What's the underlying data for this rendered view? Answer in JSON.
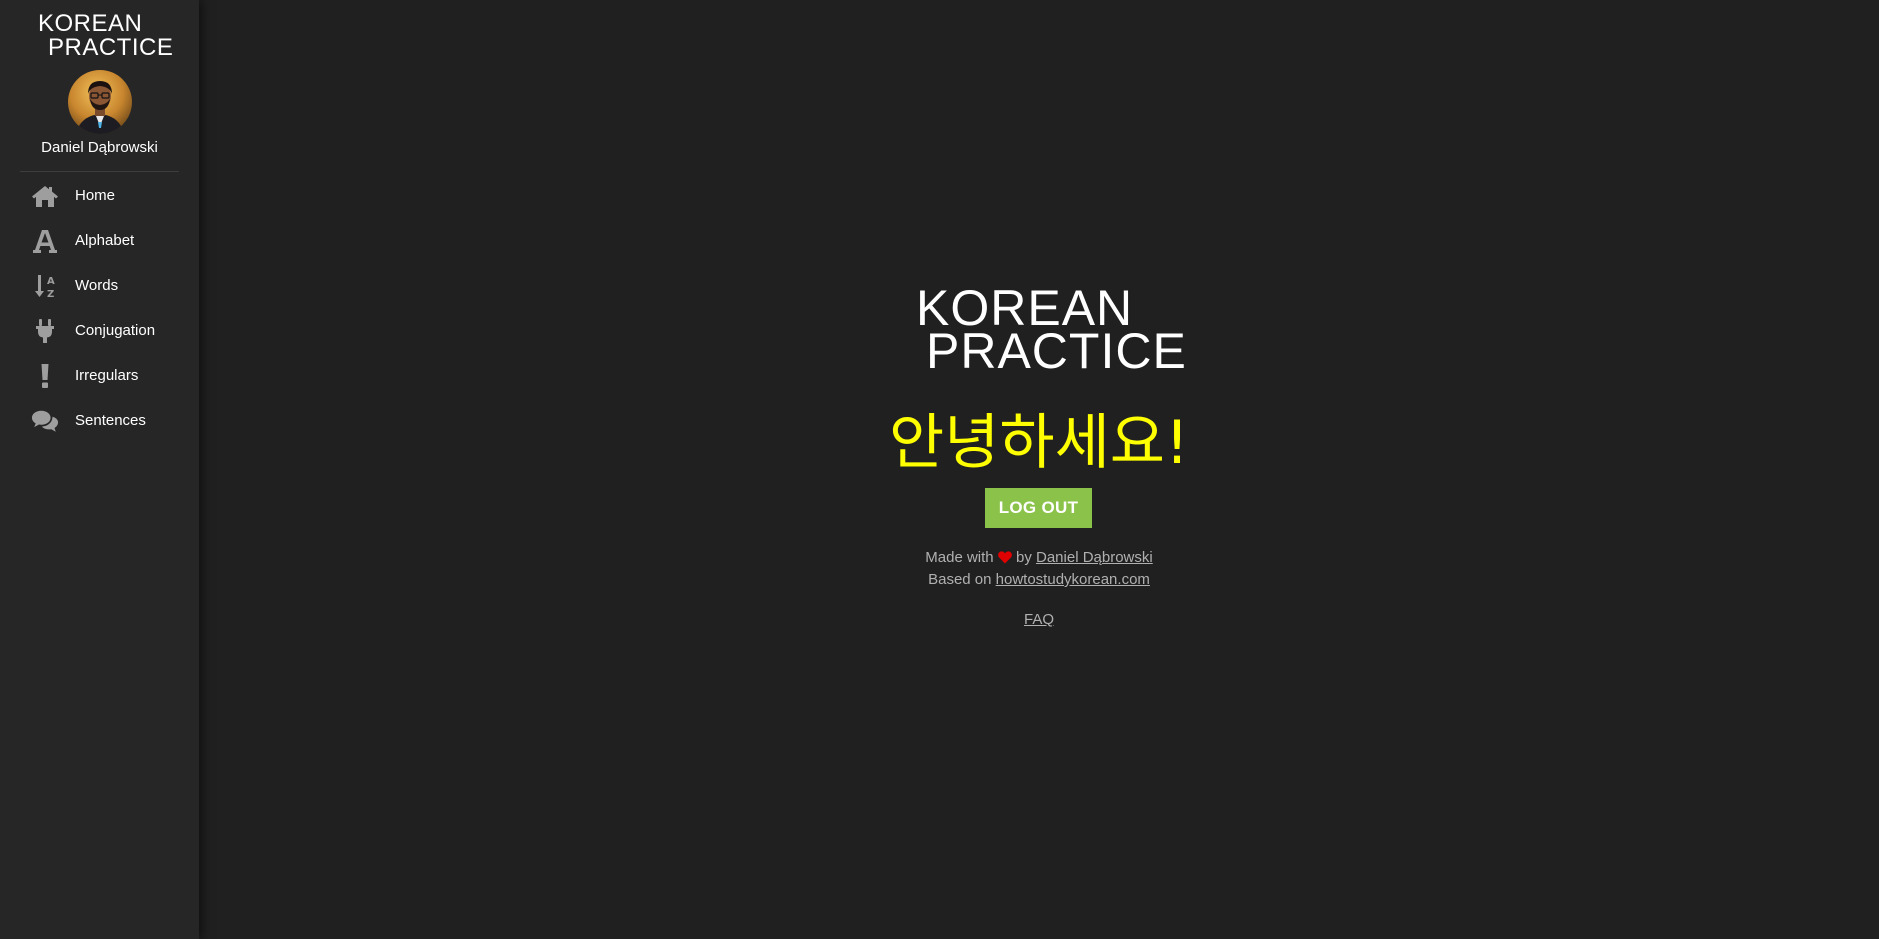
{
  "sidebar": {
    "logo_line1": "KOREAN",
    "logo_line2": "PRACTICE",
    "username": "Daniel Dąbrowski",
    "items": [
      {
        "label": "Home",
        "icon": "home-icon"
      },
      {
        "label": "Alphabet",
        "icon": "font-icon"
      },
      {
        "label": "Words",
        "icon": "sort-alpha-icon"
      },
      {
        "label": "Conjugation",
        "icon": "plug-icon"
      },
      {
        "label": "Irregulars",
        "icon": "exclamation-icon"
      },
      {
        "label": "Sentences",
        "icon": "comments-icon"
      }
    ]
  },
  "main": {
    "logo_line1": "KOREAN",
    "logo_line2": "PRACTICE",
    "greeting": "안녕하세요!",
    "logout_label": "LOG OUT",
    "footer": {
      "made_with": "Made with",
      "by": "by",
      "author_link": "Daniel Dąbrowski",
      "based_on": "Based on",
      "source_link": "howtostudykorean.com",
      "faq_link": "FAQ"
    }
  },
  "colors": {
    "background": "#202020",
    "sidebar": "#262626",
    "greeting": "#ffff00",
    "button": "#8bc34a",
    "heart": "#e00000",
    "icon": "#9e9e9e"
  }
}
